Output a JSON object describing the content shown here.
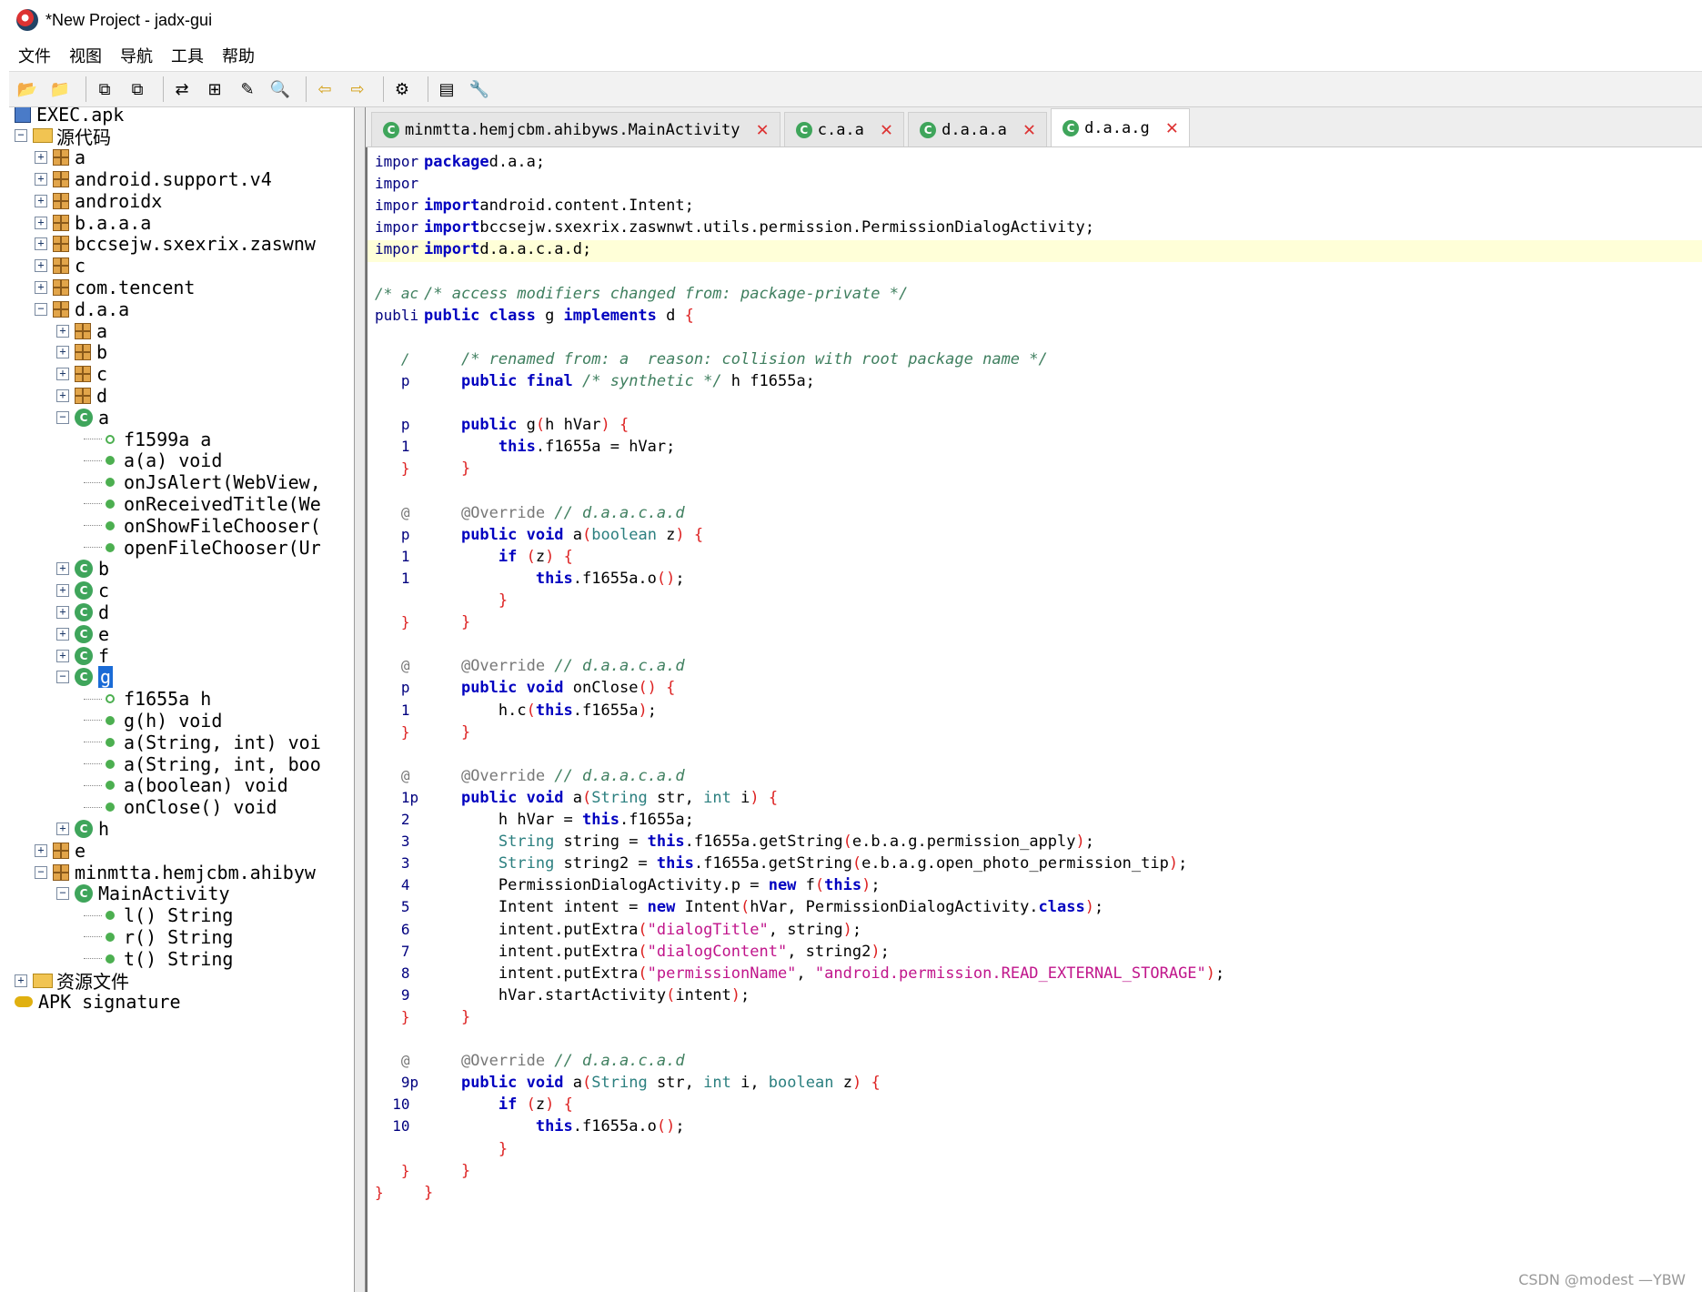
{
  "window": {
    "title": "*New Project - jadx-gui"
  },
  "menubar": [
    "文件",
    "视图",
    "导航",
    "工具",
    "帮助"
  ],
  "toolbar": [
    {
      "icon": "open-folder-icon",
      "glyph": "📂"
    },
    {
      "icon": "add-file-icon",
      "glyph": "📁"
    },
    {
      "icon": "copy-icon",
      "glyph": "⧉"
    },
    {
      "icon": "save-all-icon",
      "glyph": "⧉"
    },
    {
      "icon": "sync-tree-icon",
      "glyph": "⇄"
    },
    {
      "icon": "flatten-packages-icon",
      "glyph": "⊞"
    },
    {
      "icon": "text-search-icon",
      "glyph": "✎"
    },
    {
      "icon": "class-search-icon",
      "glyph": "🔍"
    },
    {
      "icon": "back-icon",
      "glyph": "⇦"
    },
    {
      "icon": "forward-icon",
      "glyph": "⇨"
    },
    {
      "icon": "deobfuscation-icon",
      "glyph": "⚙"
    },
    {
      "icon": "log-icon",
      "glyph": "▤"
    },
    {
      "icon": "preferences-icon",
      "glyph": "🔧"
    }
  ],
  "tree": [
    {
      "depth": 0,
      "kind": "apk",
      "exp": "",
      "label": "EXEC.apk"
    },
    {
      "depth": 0,
      "kind": "src",
      "exp": "−",
      "label": "源代码"
    },
    {
      "depth": 1,
      "kind": "pkg",
      "exp": "+",
      "label": "a"
    },
    {
      "depth": 1,
      "kind": "pkg",
      "exp": "+",
      "label": "android.support.v4"
    },
    {
      "depth": 1,
      "kind": "pkg",
      "exp": "+",
      "label": "androidx"
    },
    {
      "depth": 1,
      "kind": "pkg",
      "exp": "+",
      "label": "b.a.a.a"
    },
    {
      "depth": 1,
      "kind": "pkg",
      "exp": "+",
      "label": "bccsejw.sxexrix.zaswnw"
    },
    {
      "depth": 1,
      "kind": "pkg",
      "exp": "+",
      "label": "c"
    },
    {
      "depth": 1,
      "kind": "pkg",
      "exp": "+",
      "label": "com.tencent"
    },
    {
      "depth": 1,
      "kind": "pkg",
      "exp": "−",
      "label": "d.a.a"
    },
    {
      "depth": 2,
      "kind": "pkg",
      "exp": "+",
      "label": "a"
    },
    {
      "depth": 2,
      "kind": "pkg",
      "exp": "+",
      "label": "b"
    },
    {
      "depth": 2,
      "kind": "pkg",
      "exp": "+",
      "label": "c"
    },
    {
      "depth": 2,
      "kind": "pkg",
      "exp": "+",
      "label": "d"
    },
    {
      "depth": 2,
      "kind": "cls",
      "exp": "−",
      "label": "a"
    },
    {
      "depth": 3,
      "kind": "fld",
      "exp": "",
      "label": "f1599a a"
    },
    {
      "depth": 3,
      "kind": "mth",
      "exp": "",
      "label": "a(a) void"
    },
    {
      "depth": 3,
      "kind": "mth",
      "exp": "",
      "label": "onJsAlert(WebView,"
    },
    {
      "depth": 3,
      "kind": "mth",
      "exp": "",
      "label": "onReceivedTitle(We"
    },
    {
      "depth": 3,
      "kind": "mth",
      "exp": "",
      "label": "onShowFileChooser("
    },
    {
      "depth": 3,
      "kind": "mth",
      "exp": "",
      "label": "openFileChooser(Ur"
    },
    {
      "depth": 2,
      "kind": "cls",
      "exp": "+",
      "label": "b"
    },
    {
      "depth": 2,
      "kind": "cls",
      "exp": "+",
      "label": "c"
    },
    {
      "depth": 2,
      "kind": "cls",
      "exp": "+",
      "label": "d"
    },
    {
      "depth": 2,
      "kind": "cls",
      "exp": "+",
      "label": "e"
    },
    {
      "depth": 2,
      "kind": "cls",
      "exp": "+",
      "label": "f"
    },
    {
      "depth": 2,
      "kind": "cls",
      "exp": "−",
      "label": "g",
      "selected": true
    },
    {
      "depth": 3,
      "kind": "fld",
      "exp": "",
      "label": "f1655a h"
    },
    {
      "depth": 3,
      "kind": "mth",
      "exp": "",
      "label": "g(h) void"
    },
    {
      "depth": 3,
      "kind": "mth",
      "exp": "",
      "label": "a(String, int) voi"
    },
    {
      "depth": 3,
      "kind": "mth",
      "exp": "",
      "label": "a(String, int, boo"
    },
    {
      "depth": 3,
      "kind": "mth",
      "exp": "",
      "label": "a(boolean) void"
    },
    {
      "depth": 3,
      "kind": "mth",
      "exp": "",
      "label": "onClose() void"
    },
    {
      "depth": 2,
      "kind": "cls",
      "exp": "+",
      "label": "h"
    },
    {
      "depth": 1,
      "kind": "pkg",
      "exp": "+",
      "label": "e"
    },
    {
      "depth": 1,
      "kind": "pkg",
      "exp": "−",
      "label": "minmtta.hemjcbm.ahibyw"
    },
    {
      "depth": 2,
      "kind": "cls",
      "exp": "−",
      "label": "MainActivity"
    },
    {
      "depth": 3,
      "kind": "mth",
      "exp": "",
      "label": "l() String"
    },
    {
      "depth": 3,
      "kind": "mth",
      "exp": "",
      "label": "r() String"
    },
    {
      "depth": 3,
      "kind": "mth",
      "exp": "",
      "label": "t() String"
    },
    {
      "depth": 0,
      "kind": "res",
      "exp": "+",
      "label": "资源文件"
    },
    {
      "depth": 0,
      "kind": "key",
      "exp": "",
      "label": "APK signature"
    }
  ],
  "tabs": [
    {
      "label": "minmtta.hemjcbm.ahibyws.MainActivity",
      "active": false
    },
    {
      "label": "c.a.a",
      "active": false
    },
    {
      "label": "d.a.a.a",
      "active": false
    },
    {
      "label": "d.a.a.g",
      "active": true
    }
  ],
  "code": [
    {
      "g": "impor",
      "t": [
        [
          "kw",
          "package"
        ],
        [
          "",
          "d.a.a;"
        ]
      ]
    },
    {
      "g": "impor",
      "t": []
    },
    {
      "g": "impor",
      "t": [
        [
          "kw",
          "import"
        ],
        [
          "",
          "android.content.Intent;"
        ]
      ]
    },
    {
      "g": "impor",
      "t": [
        [
          "kw",
          "import"
        ],
        [
          "",
          "bccsejw.sxexrix.zaswnwt.utils.permission.PermissionDialogActivity;"
        ]
      ]
    },
    {
      "g": "impor",
      "t": [
        [
          "kw",
          "import"
        ],
        [
          "",
          "d.a.a.c.a.d;"
        ]
      ],
      "hl": true
    },
    {
      "g": "",
      "t": []
    },
    {
      "g": "/* ac",
      "gc": "cm",
      "t": [
        [
          "cm",
          "/* access modifiers changed from: package-private */"
        ]
      ]
    },
    {
      "g": "publi",
      "t": [
        [
          "kw",
          "public class"
        ],
        [
          "",
          " g "
        ],
        [
          "kw",
          "implements"
        ],
        [
          "",
          " d "
        ],
        [
          "br",
          "{"
        ]
      ]
    },
    {
      "g": "",
      "t": []
    },
    {
      "g": "   /",
      "gc": "cm",
      "t": [
        [
          "",
          "    "
        ],
        [
          "cm",
          "/* renamed from: a  reason: collision with root package name */"
        ]
      ]
    },
    {
      "g": "   p",
      "t": [
        [
          "",
          "    "
        ],
        [
          "kw",
          "public final"
        ],
        [
          "",
          " "
        ],
        [
          "cm",
          "/* synthetic */"
        ],
        [
          "",
          " h f1655a;"
        ]
      ]
    },
    {
      "g": "",
      "t": []
    },
    {
      "g": "   p",
      "t": [
        [
          "",
          "    "
        ],
        [
          "kw",
          "public"
        ],
        [
          "",
          " g"
        ],
        [
          "br",
          "("
        ],
        [
          "",
          "h hVar"
        ],
        [
          "br",
          ")"
        ],
        [
          "",
          " "
        ],
        [
          "br",
          "{"
        ]
      ]
    },
    {
      "g": "   1",
      "t": [
        [
          "",
          "        "
        ],
        [
          "kw",
          "this"
        ],
        [
          "",
          ".f1655a = hVar;"
        ]
      ]
    },
    {
      "g": "   }",
      "gc": "br",
      "t": [
        [
          "",
          "    "
        ],
        [
          "br",
          "}"
        ]
      ]
    },
    {
      "g": "",
      "t": []
    },
    {
      "g": "   @",
      "gc": "an",
      "t": [
        [
          "",
          "    "
        ],
        [
          "an",
          "@Override"
        ],
        [
          "",
          " "
        ],
        [
          "cm",
          "// d.a.a.c.a.d"
        ]
      ]
    },
    {
      "g": "   p",
      "t": [
        [
          "",
          "    "
        ],
        [
          "kw",
          "public void"
        ],
        [
          "",
          " a"
        ],
        [
          "br",
          "("
        ],
        [
          "ty",
          "boolean"
        ],
        [
          "",
          " z"
        ],
        [
          "br",
          ")"
        ],
        [
          "",
          " "
        ],
        [
          "br",
          "{"
        ]
      ]
    },
    {
      "g": "   1",
      "t": [
        [
          "",
          "        "
        ],
        [
          "kw",
          "if"
        ],
        [
          "",
          " "
        ],
        [
          "br",
          "("
        ],
        [
          "",
          "z"
        ],
        [
          "br",
          ")"
        ],
        [
          "",
          " "
        ],
        [
          "br",
          "{"
        ]
      ]
    },
    {
      "g": "   1",
      "t": [
        [
          "",
          "            "
        ],
        [
          "kw",
          "this"
        ],
        [
          "",
          ".f1655a.o"
        ],
        [
          "br",
          "()"
        ],
        [
          "",
          ";"
        ]
      ]
    },
    {
      "g": "",
      "t": [
        [
          "",
          "        "
        ],
        [
          "br",
          "}"
        ]
      ]
    },
    {
      "g": "   }",
      "gc": "br",
      "t": [
        [
          "",
          "    "
        ],
        [
          "br",
          "}"
        ]
      ]
    },
    {
      "g": "",
      "t": []
    },
    {
      "g": "   @",
      "gc": "an",
      "t": [
        [
          "",
          "    "
        ],
        [
          "an",
          "@Override"
        ],
        [
          "",
          " "
        ],
        [
          "cm",
          "// d.a.a.c.a.d"
        ]
      ]
    },
    {
      "g": "   p",
      "t": [
        [
          "",
          "    "
        ],
        [
          "kw",
          "public void"
        ],
        [
          "",
          " onClose"
        ],
        [
          "br",
          "()"
        ],
        [
          "",
          " "
        ],
        [
          "br",
          "{"
        ]
      ]
    },
    {
      "g": "   1",
      "t": [
        [
          "",
          "        h.c"
        ],
        [
          "br",
          "("
        ],
        [
          "kw",
          "this"
        ],
        [
          "",
          ".f1655a"
        ],
        [
          "br",
          ")"
        ],
        [
          "",
          ";"
        ]
      ]
    },
    {
      "g": "   }",
      "gc": "br",
      "t": [
        [
          "",
          "    "
        ],
        [
          "br",
          "}"
        ]
      ]
    },
    {
      "g": "",
      "t": []
    },
    {
      "g": "   @",
      "gc": "an",
      "t": [
        [
          "",
          "    "
        ],
        [
          "an",
          "@Override"
        ],
        [
          "",
          " "
        ],
        [
          "cm",
          "// d.a.a.c.a.d"
        ]
      ]
    },
    {
      "g": "   1p",
      "t": [
        [
          "",
          "    "
        ],
        [
          "kw",
          "public void"
        ],
        [
          "",
          " a"
        ],
        [
          "br",
          "("
        ],
        [
          "ty",
          "String"
        ],
        [
          "",
          " str, "
        ],
        [
          "ty",
          "int"
        ],
        [
          "",
          " i"
        ],
        [
          "br",
          ")"
        ],
        [
          "",
          " "
        ],
        [
          "br",
          "{"
        ]
      ]
    },
    {
      "g": "   2",
      "t": [
        [
          "",
          "        h hVar = "
        ],
        [
          "kw",
          "this"
        ],
        [
          "",
          ".f1655a;"
        ]
      ]
    },
    {
      "g": "   3",
      "t": [
        [
          "",
          "        "
        ],
        [
          "ty",
          "String"
        ],
        [
          "",
          " string = "
        ],
        [
          "kw",
          "this"
        ],
        [
          "",
          ".f1655a.getString"
        ],
        [
          "br",
          "("
        ],
        [
          "",
          "e.b.a.g.permission_apply"
        ],
        [
          "br",
          ")"
        ],
        [
          "",
          ";"
        ]
      ]
    },
    {
      "g": "   3",
      "t": [
        [
          "",
          "        "
        ],
        [
          "ty",
          "String"
        ],
        [
          "",
          " string2 = "
        ],
        [
          "kw",
          "this"
        ],
        [
          "",
          ".f1655a.getString"
        ],
        [
          "br",
          "("
        ],
        [
          "",
          "e.b.a.g.open_photo_permission_tip"
        ],
        [
          "br",
          ")"
        ],
        [
          "",
          ";"
        ]
      ]
    },
    {
      "g": "   4",
      "t": [
        [
          "",
          "        PermissionDialogActivity.p = "
        ],
        [
          "kw",
          "new"
        ],
        [
          "",
          " f"
        ],
        [
          "br",
          "("
        ],
        [
          "kw",
          "this"
        ],
        [
          "br",
          ")"
        ],
        [
          "",
          ";"
        ]
      ]
    },
    {
      "g": "   5",
      "t": [
        [
          "",
          "        Intent intent = "
        ],
        [
          "kw",
          "new"
        ],
        [
          "",
          " Intent"
        ],
        [
          "br",
          "("
        ],
        [
          "",
          "hVar, PermissionDialogActivity."
        ],
        [
          "kw",
          "class"
        ],
        [
          "br",
          ")"
        ],
        [
          "",
          ";"
        ]
      ]
    },
    {
      "g": "   6",
      "t": [
        [
          "",
          "        intent.putExtra"
        ],
        [
          "br",
          "("
        ],
        [
          "st",
          "\"dialogTitle\""
        ],
        [
          "",
          ", string"
        ],
        [
          "br",
          ")"
        ],
        [
          "",
          ";"
        ]
      ]
    },
    {
      "g": "   7",
      "t": [
        [
          "",
          "        intent.putExtra"
        ],
        [
          "br",
          "("
        ],
        [
          "st",
          "\"dialogContent\""
        ],
        [
          "",
          ", string2"
        ],
        [
          "br",
          ")"
        ],
        [
          "",
          ";"
        ]
      ]
    },
    {
      "g": "   8",
      "t": [
        [
          "",
          "        intent.putExtra"
        ],
        [
          "br",
          "("
        ],
        [
          "st",
          "\"permissionName\""
        ],
        [
          "",
          ", "
        ],
        [
          "st",
          "\"android.permission.READ_EXTERNAL_STORAGE\""
        ],
        [
          "br",
          ")"
        ],
        [
          "",
          ";"
        ]
      ]
    },
    {
      "g": "   9",
      "t": [
        [
          "",
          "        hVar.startActivity"
        ],
        [
          "br",
          "("
        ],
        [
          "",
          "intent"
        ],
        [
          "br",
          ")"
        ],
        [
          "",
          ";"
        ]
      ]
    },
    {
      "g": "   }",
      "gc": "br",
      "t": [
        [
          "",
          "    "
        ],
        [
          "br",
          "}"
        ]
      ]
    },
    {
      "g": "",
      "t": []
    },
    {
      "g": "   @",
      "gc": "an",
      "t": [
        [
          "",
          "    "
        ],
        [
          "an",
          "@Override"
        ],
        [
          "",
          " "
        ],
        [
          "cm",
          "// d.a.a.c.a.d"
        ]
      ]
    },
    {
      "g": "   9p",
      "t": [
        [
          "",
          "    "
        ],
        [
          "kw",
          "public void"
        ],
        [
          "",
          " a"
        ],
        [
          "br",
          "("
        ],
        [
          "ty",
          "String"
        ],
        [
          "",
          " str, "
        ],
        [
          "ty",
          "int"
        ],
        [
          "",
          " i, "
        ],
        [
          "ty",
          "boolean"
        ],
        [
          "",
          " z"
        ],
        [
          "br",
          ")"
        ],
        [
          "",
          " "
        ],
        [
          "br",
          "{"
        ]
      ]
    },
    {
      "g": "  10",
      "t": [
        [
          "",
          "        "
        ],
        [
          "kw",
          "if"
        ],
        [
          "",
          " "
        ],
        [
          "br",
          "("
        ],
        [
          "",
          "z"
        ],
        [
          "br",
          ")"
        ],
        [
          "",
          " "
        ],
        [
          "br",
          "{"
        ]
      ]
    },
    {
      "g": "  10",
      "t": [
        [
          "",
          "            "
        ],
        [
          "kw",
          "this"
        ],
        [
          "",
          ".f1655a.o"
        ],
        [
          "br",
          "()"
        ],
        [
          "",
          ";"
        ]
      ]
    },
    {
      "g": "",
      "t": [
        [
          "",
          "        "
        ],
        [
          "br",
          "}"
        ]
      ]
    },
    {
      "g": "   }",
      "gc": "br",
      "t": [
        [
          "",
          "    "
        ],
        [
          "br",
          "}"
        ]
      ]
    },
    {
      "g": "}",
      "gc": "br",
      "t": [
        [
          "br",
          "}"
        ]
      ]
    }
  ],
  "watermark": "CSDN @modest —YBW"
}
